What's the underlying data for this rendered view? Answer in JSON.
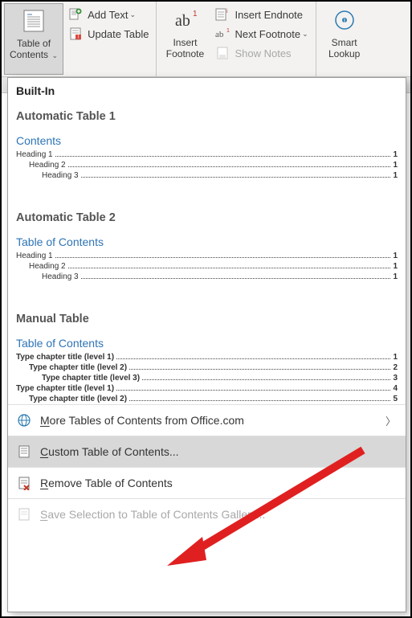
{
  "ribbon": {
    "toc_btn": {
      "line1": "Table of",
      "line2": "Contents"
    },
    "add_text": "Add Text",
    "update_table": "Update Table",
    "insert_footnote": {
      "line1": "Insert",
      "line2": "Footnote"
    },
    "insert_endnote": "Insert Endnote",
    "next_footnote": "Next Footnote",
    "show_notes": "Show Notes",
    "smart_lookup": {
      "line1": "Smart",
      "line2": "Lookup"
    }
  },
  "dropdown": {
    "built_in": "Built-In",
    "auto1": {
      "title": "Automatic Table 1",
      "toc_label": "Contents",
      "rows": [
        {
          "label": "Heading 1",
          "indent": 0,
          "page": "1"
        },
        {
          "label": "Heading 2",
          "indent": 1,
          "page": "1"
        },
        {
          "label": "Heading 3",
          "indent": 2,
          "page": "1"
        }
      ]
    },
    "auto2": {
      "title": "Automatic Table 2",
      "toc_label": "Table of Contents",
      "rows": [
        {
          "label": "Heading 1",
          "indent": 0,
          "page": "1"
        },
        {
          "label": "Heading 2",
          "indent": 1,
          "page": "1"
        },
        {
          "label": "Heading 3",
          "indent": 2,
          "page": "1"
        }
      ]
    },
    "manual": {
      "title": "Manual Table",
      "toc_label": "Table of Contents",
      "rows": [
        {
          "label": "Type chapter title (level 1)",
          "indent": 0,
          "page": "1"
        },
        {
          "label": "Type chapter title (level 2)",
          "indent": 1,
          "page": "2"
        },
        {
          "label": "Type chapter title (level 3)",
          "indent": 2,
          "page": "3"
        },
        {
          "label": "Type chapter title (level 1)",
          "indent": 0,
          "page": "4"
        },
        {
          "label": "Type chapter title (level 2)",
          "indent": 1,
          "page": "5"
        }
      ]
    },
    "more": "More Tables of Contents from Office.com",
    "custom": "Custom Table of Contents...",
    "remove": "Remove Table of Contents",
    "save_sel": "Save Selection to Table of Contents Gallery..."
  }
}
